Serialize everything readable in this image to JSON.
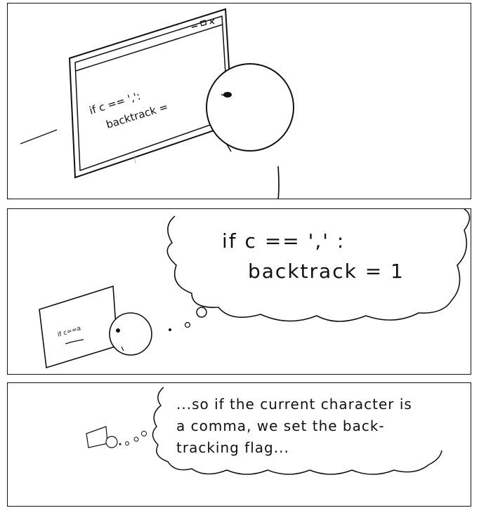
{
  "panel1": {
    "screen_line1": "if c == ',':",
    "screen_line2": "backtrack ="
  },
  "panel2": {
    "thought_line1": "if c == ',' :",
    "thought_line2": "backtrack = 1",
    "screen_scribble": "if c==a"
  },
  "panel3": {
    "thought_line1": "...so if the current character is",
    "thought_line2": "a comma, we set the back-",
    "thought_line3": "tracking flag..."
  }
}
